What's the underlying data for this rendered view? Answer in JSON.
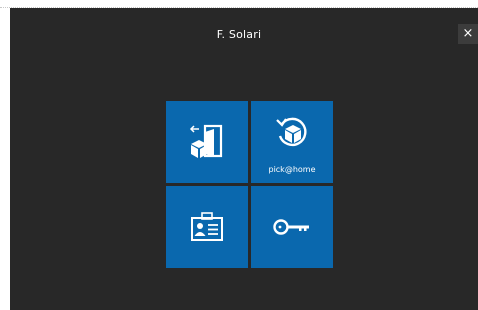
{
  "app": {
    "title": "F. Solari",
    "close_glyph": "×"
  },
  "tiles": [
    {
      "icon": "door-exit-icon",
      "label": ""
    },
    {
      "icon": "package-return-icon",
      "label": "pick@home"
    },
    {
      "icon": "id-badge-icon",
      "label": ""
    },
    {
      "icon": "key-icon",
      "label": ""
    }
  ],
  "colors": {
    "background": "#282828",
    "tile": "#0a68ae",
    "text": "#ffffff"
  }
}
